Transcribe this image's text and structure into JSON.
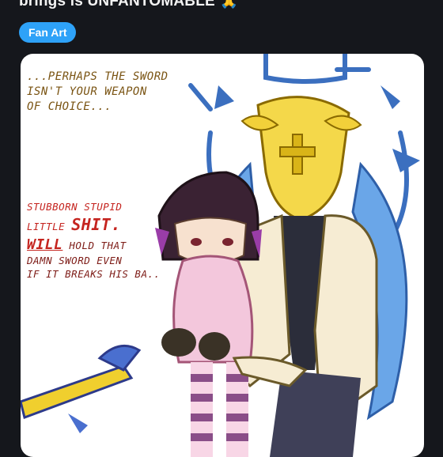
{
  "post": {
    "title_text": "brings is UNFANTOMABLE",
    "title_emoji": "🙏",
    "flair": "Fan Art"
  },
  "artwork": {
    "caption_top_lines": [
      "...PERHAPS THE SWORD",
      "ISN'T YOUR WEAPON",
      "OF CHOICE..."
    ],
    "caption_red": {
      "line1": "STUBBORN STUPID",
      "line2_pre": "LITTLE",
      "line2_big": "SHIT.",
      "line3_und": "WILL",
      "line3_rest": "HOLD THAT",
      "line4": "DAMN SWORD EVEN",
      "line5": "IF IT BREAKS HIS BA.."
    }
  }
}
